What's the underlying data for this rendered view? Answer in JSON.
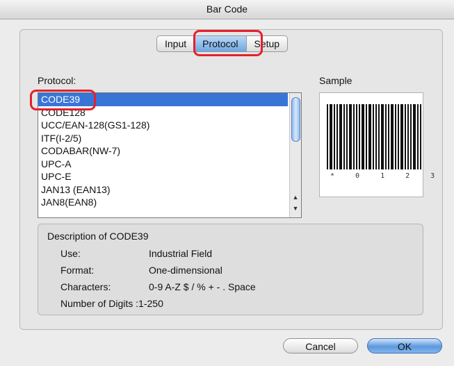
{
  "window": {
    "title": "Bar Code"
  },
  "tabs": [
    {
      "label": "Input",
      "active": false
    },
    {
      "label": "Protocol",
      "active": true
    },
    {
      "label": "Setup",
      "active": false
    }
  ],
  "protocol": {
    "label": "Protocol:",
    "items": [
      "CODE39",
      "CODE128",
      "UCC/EAN-128(GS1-128)",
      "ITF(I-2/5)",
      "CODABAR(NW-7)",
      "UPC-A",
      "UPC-E",
      "JAN13 (EAN13)",
      "JAN8(EAN8)"
    ],
    "selected": "CODE39"
  },
  "sample": {
    "label": "Sample",
    "digits": [
      "*",
      "0",
      "1",
      "2",
      "3"
    ]
  },
  "description": {
    "title": "Description of CODE39",
    "rows": [
      {
        "key": "Use:",
        "value": "Industrial Field"
      },
      {
        "key": "Format:",
        "value": "One-dimensional"
      },
      {
        "key": "Characters:",
        "value": "0-9 A-Z $ / % + - . Space"
      },
      {
        "key": "Number of Digits :",
        "value": "1-250"
      }
    ]
  },
  "buttons": {
    "cancel": "Cancel",
    "ok": "OK"
  },
  "colors": {
    "highlight": "#e4202c",
    "selection": "#3875d7",
    "ok_button": "#5c98dd"
  },
  "icons": {
    "scroll_up": "up-arrow-icon",
    "scroll_down": "down-arrow-icon"
  }
}
